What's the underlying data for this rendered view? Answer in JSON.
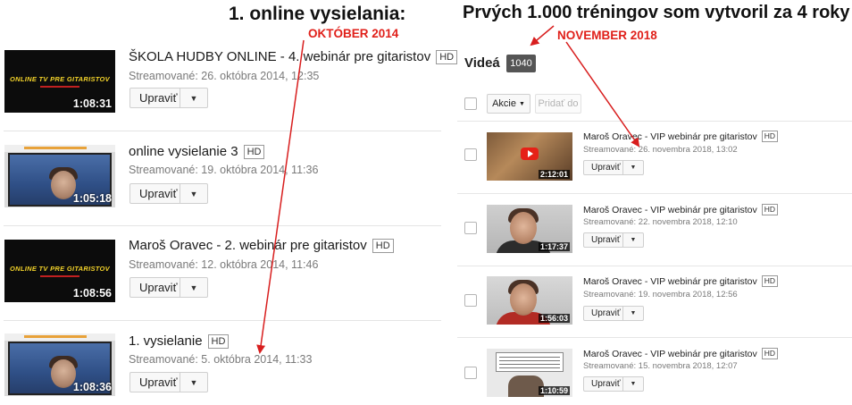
{
  "annotations": {
    "left_title": "1. online vysielania:",
    "left_date": "OKTÓBER 2014",
    "right_title": "Prvých 1.000 tréningov som vytvoril za 4 roky",
    "right_date": "NOVEMBER 2018",
    "arrow_color": "#d81e1e"
  },
  "left_list": {
    "edit_label": "Upraviť",
    "hd_label": "HD",
    "items": [
      {
        "title": "ŠKOLA HUDBY ONLINE - 4. webinár pre gitaristov",
        "streamed": "Streamované: 26. októbra 2014, 12:35",
        "duration": "1:08:31",
        "thumb_text": "ONLINE TV PRE GITARISTOV",
        "thumb": "logo"
      },
      {
        "title": "online vysielanie 3",
        "streamed": "Streamované: 19. októbra 2014, 11:36",
        "duration": "1:05:18",
        "thumb": "webcam"
      },
      {
        "title": "Maroš Oravec - 2. webinár pre gitaristov",
        "streamed": "Streamované: 12. októbra 2014, 11:46",
        "duration": "1:08:56",
        "thumb_text": "ONLINE TV PRE GITARISTOV",
        "thumb": "logo"
      },
      {
        "title": "1. vysielanie",
        "streamed": "Streamované: 5. októbra 2014, 11:33",
        "duration": "1:08:36",
        "thumb": "webcam"
      }
    ]
  },
  "right_panel": {
    "heading": "Videá",
    "count": "1040",
    "actions_label": "Akcie",
    "add_to_label": "Pridať do",
    "edit_label": "Upraviť",
    "hd_label": "HD",
    "items": [
      {
        "title": "Maroš Oravec - VIP webinár pre gitaristov",
        "streamed": "Streamované: 26. novembra 2018, 13:02",
        "duration": "2:12:01",
        "thumb": "guitar"
      },
      {
        "title": "Maroš Oravec - VIP webinár pre gitaristov",
        "streamed": "Streamované: 22. novembra 2018, 12:10",
        "duration": "1:17:37",
        "thumb": "room"
      },
      {
        "title": "Maroš Oravec - VIP webinár pre gitaristov",
        "streamed": "Streamované: 19. novembra 2018, 12:56",
        "duration": "1:56:03",
        "thumb": "room-red"
      },
      {
        "title": "Maroš Oravec - VIP webinár pre gitaristov",
        "streamed": "Streamované: 15. novembra 2018, 12:07",
        "duration": "1:10:59",
        "thumb": "board"
      }
    ]
  }
}
